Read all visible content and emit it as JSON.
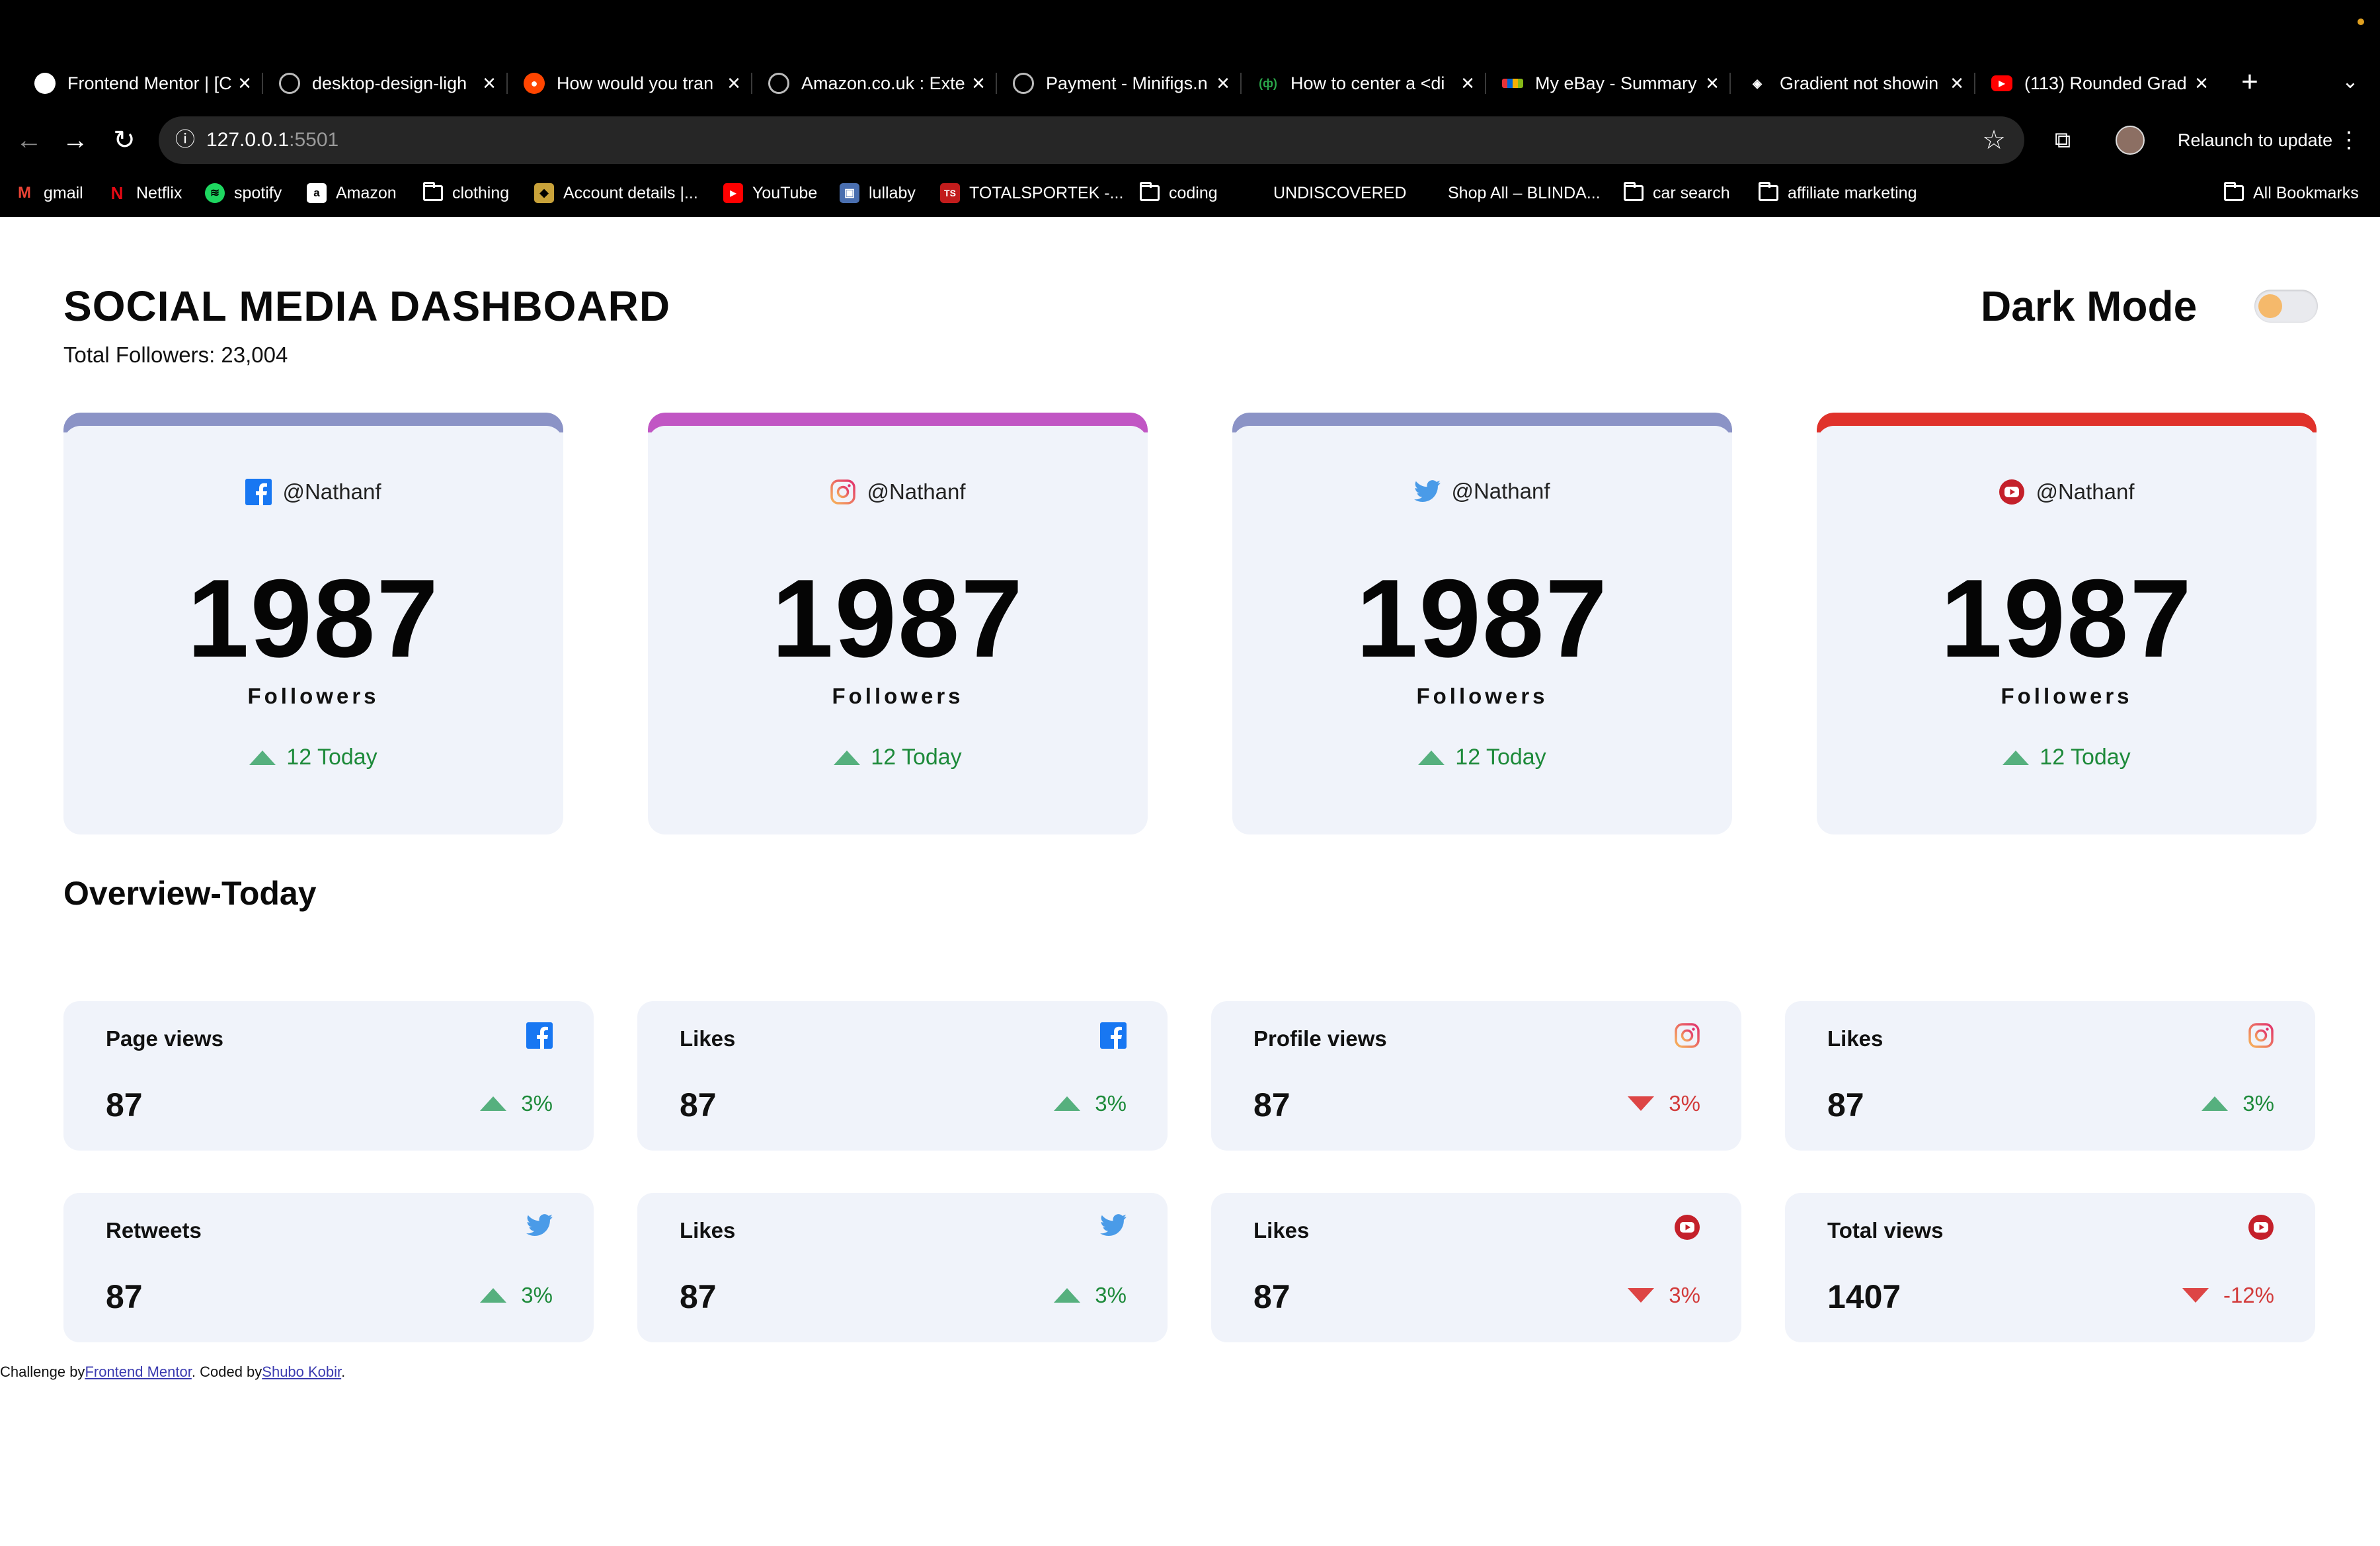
{
  "browser": {
    "tabs": [
      {
        "title": "Frontend Mentor | [C",
        "favicon": "frontend-mentor-icon"
      },
      {
        "title": "desktop-design-ligh",
        "favicon": "globe-icon"
      },
      {
        "title": "How would you tran",
        "favicon": "reddit-icon"
      },
      {
        "title": "Amazon.co.uk : Exte",
        "favicon": "globe-icon"
      },
      {
        "title": "Payment - Minifigs.n",
        "favicon": "globe-icon"
      },
      {
        "title": "How to center a <di",
        "favicon": "freecodecamp-icon"
      },
      {
        "title": "My eBay - Summary",
        "favicon": "ebay-icon"
      },
      {
        "title": "Gradient not showin",
        "favicon": "diamond-icon"
      },
      {
        "title": "(113) Rounded Grad",
        "favicon": "youtube-icon"
      }
    ],
    "url_host": "127.0.0.1",
    "url_port": ":5501",
    "relaunch_label": "Relaunch to update",
    "bookmarks": [
      {
        "label": "gmail",
        "icon": "gmail-icon"
      },
      {
        "label": "Netflix",
        "icon": "netflix-icon"
      },
      {
        "label": "spotify",
        "icon": "spotify-icon"
      },
      {
        "label": "Amazon",
        "icon": "amazon-icon"
      },
      {
        "label": "clothing",
        "icon": "folder-icon"
      },
      {
        "label": "Account details |...",
        "icon": "shield-icon"
      },
      {
        "label": "YouTube",
        "icon": "youtube-icon"
      },
      {
        "label": "lullaby",
        "icon": "image-icon"
      },
      {
        "label": "TOTALSPORTEK -...",
        "icon": "ts-icon"
      },
      {
        "label": "coding",
        "icon": "folder-icon"
      },
      {
        "label": "UNDISCOVERED",
        "icon": "blank-icon"
      },
      {
        "label": "Shop All – BLINDA...",
        "icon": "blank-icon"
      },
      {
        "label": "car search",
        "icon": "folder-icon"
      },
      {
        "label": "affiliate marketing",
        "icon": "folder-icon"
      }
    ],
    "all_bookmarks_label": "All Bookmarks"
  },
  "header": {
    "title": "SOCIAL MEDIA DASHBOARD",
    "total_followers": "Total Followers: 23,004",
    "dark_mode_label": "Dark Mode"
  },
  "colors": {
    "facebook": "#8b93c6",
    "instagram": "#c156c4",
    "twitter": "#8b93c6",
    "youtube": "#e0322b",
    "up": "#1d8a3a",
    "down": "#d23a3a",
    "card_bg": "#f0f3fa"
  },
  "follower_cards": [
    {
      "platform": "facebook",
      "handle": "@Nathanf",
      "count": "1987",
      "label": "Followers",
      "today": "12 Today"
    },
    {
      "platform": "instagram",
      "handle": "@Nathanf",
      "count": "1987",
      "label": "Followers",
      "today": "12 Today"
    },
    {
      "platform": "twitter",
      "handle": "@Nathanf",
      "count": "1987",
      "label": "Followers",
      "today": "12 Today"
    },
    {
      "platform": "youtube",
      "handle": "@Nathanf",
      "count": "1987",
      "label": "Followers",
      "today": "12 Today"
    }
  ],
  "overview": {
    "title": "Overview-Today",
    "cards": [
      {
        "label": "Page views",
        "platform": "facebook",
        "value": "87",
        "change": "3%",
        "direction": "up"
      },
      {
        "label": "Likes",
        "platform": "facebook",
        "value": "87",
        "change": "3%",
        "direction": "up"
      },
      {
        "label": "Profile views",
        "platform": "instagram",
        "value": "87",
        "change": "3%",
        "direction": "down"
      },
      {
        "label": "Likes",
        "platform": "instagram",
        "value": "87",
        "change": "3%",
        "direction": "up"
      },
      {
        "label": "Retweets",
        "platform": "twitter",
        "value": "87",
        "change": "3%",
        "direction": "up"
      },
      {
        "label": "Likes",
        "platform": "twitter",
        "value": "87",
        "change": "3%",
        "direction": "up"
      },
      {
        "label": "Likes",
        "platform": "youtube",
        "value": "87",
        "change": "3%",
        "direction": "down"
      },
      {
        "label": "Total views",
        "platform": "youtube",
        "value": "1407",
        "change": "-12%",
        "direction": "down"
      }
    ]
  },
  "footer": {
    "prefix": "Challenge by",
    "link1": "Frontend Mentor",
    "middle": ". Coded by",
    "link2": "Shubo Kobir",
    "suffix": "."
  }
}
